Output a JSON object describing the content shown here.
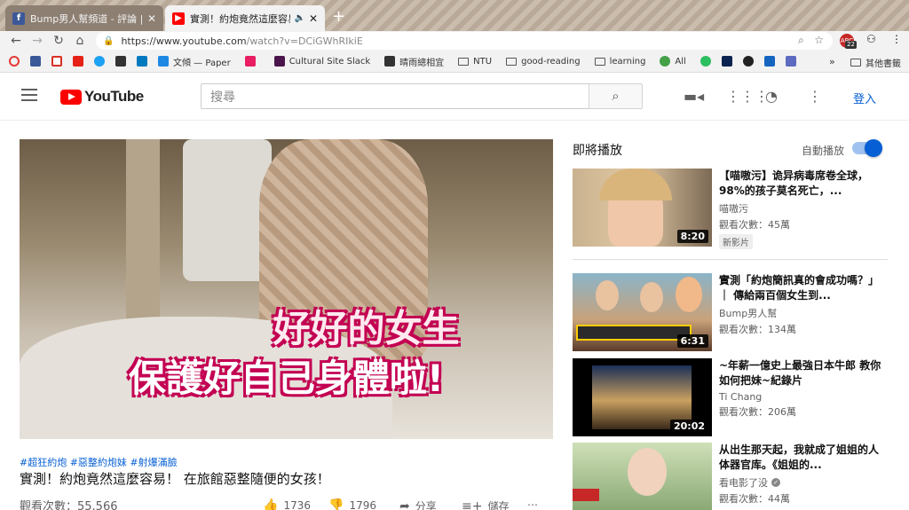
{
  "browser": {
    "tabs": [
      {
        "title": "Bump男人幫頻道 - 評論 | Facebook",
        "close": "✕",
        "icon_color": "#3b5998"
      },
      {
        "title": "實測！約炮竟然這麼容易！ 在旅館",
        "close": "✕",
        "icon_color": "#ff0000"
      }
    ],
    "new_tab": "+",
    "url_main": "https://www.youtube.com",
    "url_rest": "/watch?v=DCiGWhRIkiE",
    "extension_badge_text": "ABC",
    "extension_badge_count": "22"
  },
  "bookmarks": {
    "items": [
      {
        "label": "文傾 — Paper",
        "color": "#1e88e5"
      },
      {
        "label": "",
        "color": "#e91e63"
      },
      {
        "label": "Cultural Site Slack",
        "color": "#4a154b"
      },
      {
        "label": "晴雨總相宜",
        "color": "#333333"
      },
      {
        "label": "NTU",
        "color": ""
      },
      {
        "label": "good-reading",
        "color": ""
      },
      {
        "label": "learning",
        "color": ""
      },
      {
        "label": "All",
        "color": "#43a047"
      }
    ],
    "more": "»",
    "other": "其他書籤"
  },
  "youtube": {
    "logo": "YouTube",
    "search_placeholder": "搜尋",
    "sign_in": "登入"
  },
  "video": {
    "caption_line1": "好好的女生",
    "caption_line2": "保護好自己身體啦!",
    "tags": "#超狂約炮 #惡整約炮妹 #射爆滿臉",
    "title": "實測！約炮竟然這麼容易！ 在旅館惡整隨便的女孩！",
    "views": "觀看次數：55,566",
    "likes": "1736",
    "dislikes": "1796",
    "share": "分享",
    "save": "儲存"
  },
  "sidebar": {
    "up_next": "即將播放",
    "autoplay": "自動播放",
    "autoplay_on": true,
    "cards": [
      {
        "title": "【喵嗷污】诡异病毒席卷全球，98%的孩子莫名死亡，...",
        "channel": "喵嗷污",
        "views": "觀看次數：45萬",
        "duration": "8:20",
        "badge": "新影片",
        "verified": false
      },
      {
        "title": "實測「約炮簡訊真的會成功嗎？」｜ 傳給兩百個女生到...",
        "channel": "Bump男人幫",
        "views": "觀看次數：134萬",
        "duration": "6:31",
        "badge": "",
        "verified": false
      },
      {
        "title": "~年薪一億史上最強日本牛郎 教你如何把妹~紀錄片",
        "channel": "Ti Chang",
        "views": "觀看次數：206萬",
        "duration": "20:02",
        "badge": "",
        "verified": false
      },
      {
        "title": "从出生那天起，我就成了姐姐的人体器官库。《姐姐的...",
        "channel": "看电影了没",
        "views": "觀看次數：44萬",
        "duration": "",
        "badge": "",
        "verified": true
      }
    ]
  }
}
